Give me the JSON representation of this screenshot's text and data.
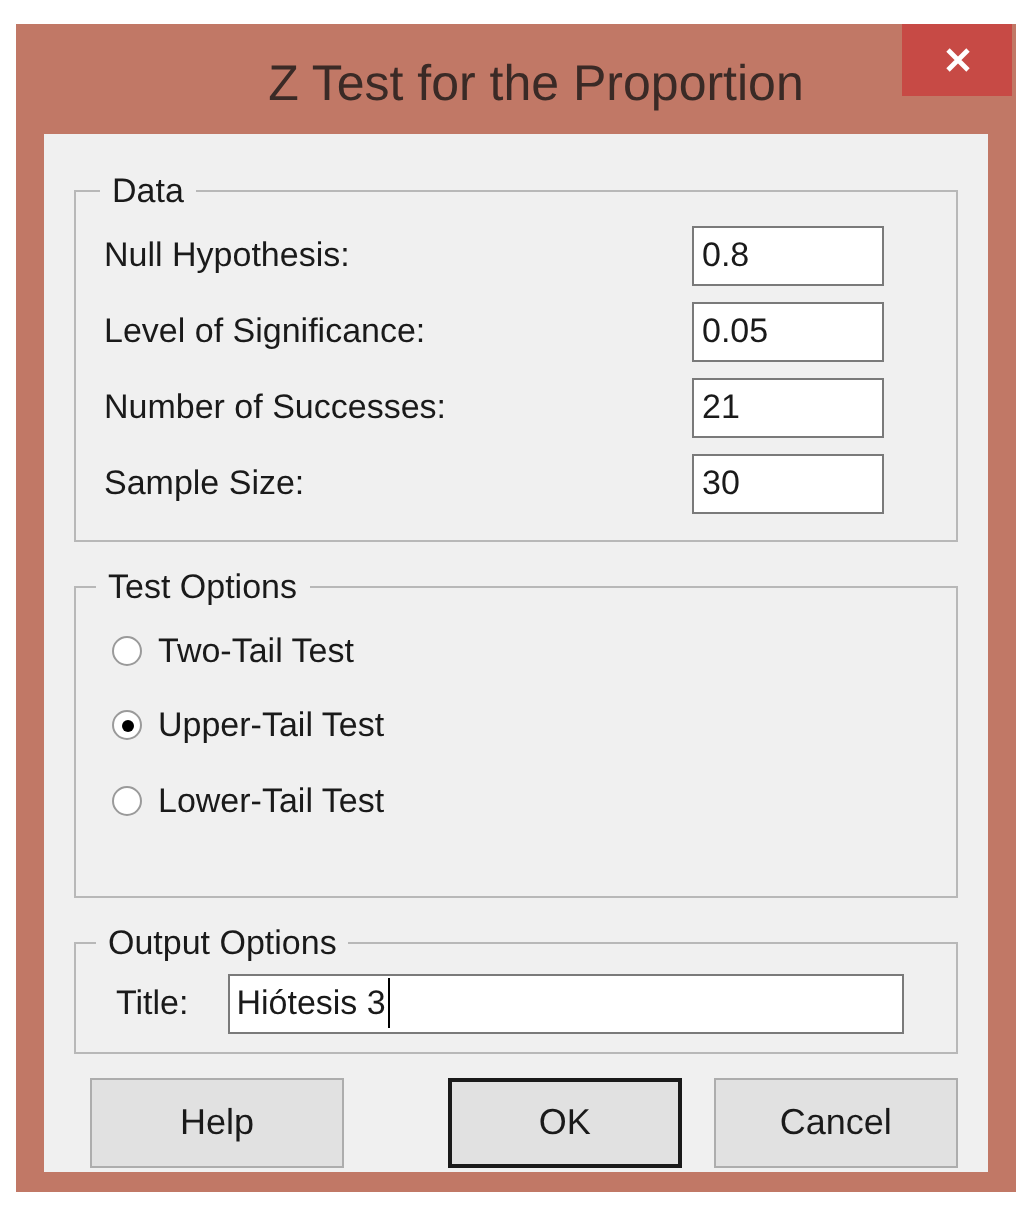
{
  "window": {
    "title": "Z Test for the Proportion"
  },
  "data_group": {
    "label": "Data",
    "fields": [
      {
        "label": "Null Hypothesis:",
        "value": "0.8"
      },
      {
        "label": "Level of Significance:",
        "value": "0.05"
      },
      {
        "label": "Number of Successes:",
        "value": "21"
      },
      {
        "label": "Sample Size:",
        "value": "30"
      }
    ]
  },
  "test_options": {
    "label": "Test Options",
    "options": [
      {
        "label": "Two-Tail Test",
        "selected": false
      },
      {
        "label": "Upper-Tail Test",
        "selected": true
      },
      {
        "label": "Lower-Tail Test",
        "selected": false
      }
    ]
  },
  "output_options": {
    "label": "Output Options",
    "title_field": {
      "label": "Title:",
      "value": "Hiótesis 3"
    }
  },
  "buttons": [
    {
      "label": "Help",
      "default": false
    },
    {
      "label": "OK",
      "default": true
    },
    {
      "label": "Cancel",
      "default": false
    }
  ]
}
